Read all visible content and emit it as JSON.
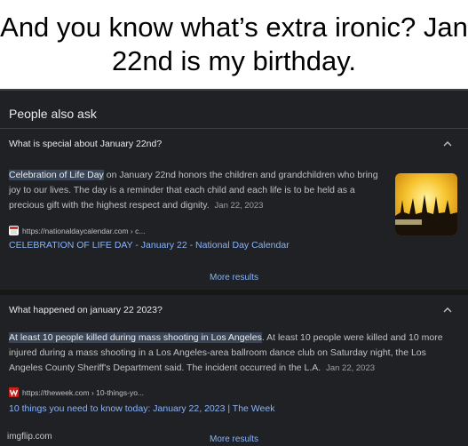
{
  "caption": "And you know what’s extra ironic? Jan 22nd is my birthday.",
  "paa": {
    "title": "People also ask",
    "more_label": "More results",
    "items": [
      {
        "question": "What is special about January 22nd?",
        "highlight": "Celebration of Life Day",
        "body": " on January 22nd honors the children and grandchildren who bring joy to our lives. The day is a reminder that each child and each life is to be held as a precious gift with the highest respect and dignity.",
        "date": "Jan 22, 2023",
        "source_url": "https://nationaldaycalendar.com › c...",
        "link_text": "CELEBRATION OF LIFE DAY - January 22 - National Day Calendar"
      },
      {
        "question": "What happened on january 22 2023?",
        "highlight": "At least 10 people killed during mass shooting in Los Angeles",
        "body": ". At least 10 people were killed and 10 more injured during a mass shooting in a Los Angeles-area ballroom dance club on Saturday night, the Los Angeles County Sheriff's Department said. The incident occurred in the L.A.",
        "date": "Jan 22, 2023",
        "source_url": "https://theweek.com › 10-things-yo...",
        "link_text": "10 things you need to know today: January 22, 2023 | The Week"
      }
    ]
  },
  "watermark": "imgflip.com",
  "colors": {
    "panel_bg": "#202124",
    "link": "#8ab4f8",
    "highlight_bg": "#394457"
  },
  "icons": [
    "chevron-up-icon",
    "nationaldaycalendar-favicon-icon",
    "theweek-favicon-icon"
  ]
}
